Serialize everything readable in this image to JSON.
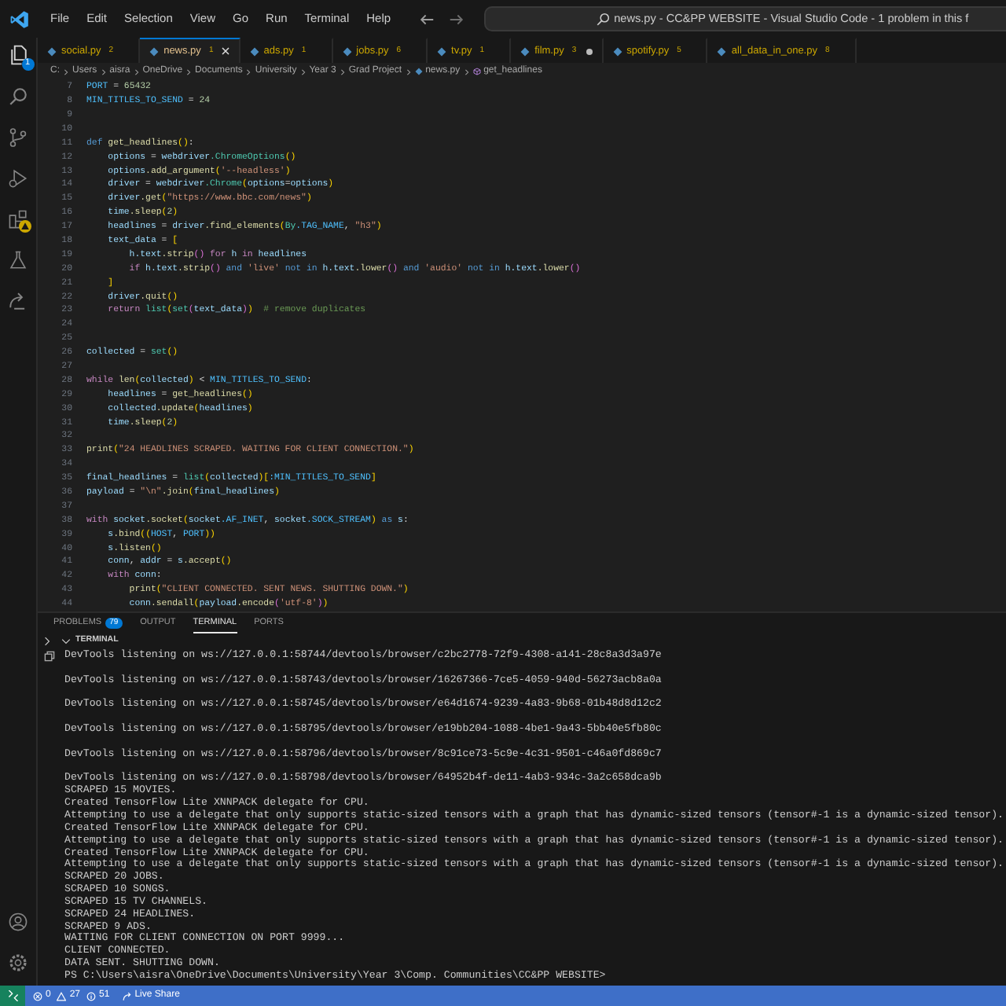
{
  "title_bar": {
    "menu": [
      "File",
      "Edit",
      "Selection",
      "View",
      "Go",
      "Run",
      "Terminal",
      "Help"
    ],
    "command_center": "news.py - CC&PP WEBSITE - Visual Studio Code - 1 problem in this f"
  },
  "activity_bar": {
    "explorer_badge": "1"
  },
  "tabs": [
    {
      "label": "social.py",
      "problems": "2",
      "selected": false,
      "modified": false
    },
    {
      "label": "news.py",
      "problems": "1",
      "selected": true,
      "modified": false
    },
    {
      "label": "ads.py",
      "problems": "1",
      "selected": false,
      "modified": false
    },
    {
      "label": "jobs.py",
      "problems": "6",
      "selected": false,
      "modified": false
    },
    {
      "label": "tv.py",
      "problems": "1",
      "selected": false,
      "modified": false
    },
    {
      "label": "film.py",
      "problems": "3",
      "selected": false,
      "modified": true
    },
    {
      "label": "spotify.py",
      "problems": "5",
      "selected": false,
      "modified": false
    },
    {
      "label": "all_data_in_one.py",
      "problems": "8",
      "selected": false,
      "modified": false
    }
  ],
  "breadcrumbs": [
    "C:",
    "Users",
    "aisra",
    "OneDrive",
    "Documents",
    "University",
    "Year 3",
    "Grad Project",
    "news.py",
    "get_headlines"
  ],
  "editor": {
    "lines": [
      {
        "number": "7",
        "tokens": [
          {
            "kind": "const",
            "text": "PORT"
          },
          {
            "kind": "op",
            "text": " = "
          },
          {
            "kind": "num",
            "text": "65432"
          }
        ]
      },
      {
        "number": "8",
        "tokens": [
          {
            "kind": "const",
            "text": "MIN_TITLES_TO_SEND"
          },
          {
            "kind": "op",
            "text": " = "
          },
          {
            "kind": "num",
            "text": "24"
          }
        ]
      },
      {
        "number": "9"
      },
      {
        "number": "10"
      },
      {
        "number": "11",
        "tokens": [
          {
            "kind": "kw",
            "text": "def "
          },
          {
            "kind": "fn",
            "text": "get_headlines"
          },
          {
            "kind": "br",
            "text": "()"
          },
          {
            "kind": "op",
            "text": ":"
          }
        ]
      },
      {
        "number": "12",
        "tokens": [
          {
            "kind": "var",
            "text": "    options"
          },
          {
            "kind": "op",
            "text": " = "
          },
          {
            "kind": "var",
            "text": "webdriver"
          },
          {
            "kind": "cls",
            "text": ".ChromeOptions"
          },
          {
            "kind": "br",
            "text": "()"
          }
        ]
      },
      {
        "number": "13",
        "tokens": [
          {
            "kind": "var",
            "text": "    options"
          },
          {
            "kind": "fn",
            "text": ".add_argument"
          },
          {
            "kind": "br",
            "text": "("
          },
          {
            "kind": "str",
            "text": "'--headless'"
          },
          {
            "kind": "br",
            "text": ")"
          }
        ]
      },
      {
        "number": "14",
        "tokens": [
          {
            "kind": "var",
            "text": "    driver"
          },
          {
            "kind": "op",
            "text": " = "
          },
          {
            "kind": "var",
            "text": "webdriver"
          },
          {
            "kind": "cls",
            "text": ".Chrome"
          },
          {
            "kind": "br",
            "text": "("
          },
          {
            "kind": "var",
            "text": "options"
          },
          {
            "kind": "op",
            "text": "="
          },
          {
            "kind": "var",
            "text": "options"
          },
          {
            "kind": "br",
            "text": ")"
          }
        ]
      },
      {
        "number": "15",
        "tokens": [
          {
            "kind": "var",
            "text": "    driver"
          },
          {
            "kind": "fn",
            "text": ".get"
          },
          {
            "kind": "br",
            "text": "("
          },
          {
            "kind": "str",
            "text": "\"https://www.bbc.com/news\""
          },
          {
            "kind": "br",
            "text": ")"
          }
        ]
      },
      {
        "number": "16",
        "tokens": [
          {
            "kind": "var",
            "text": "    time"
          },
          {
            "kind": "fn",
            "text": ".sleep"
          },
          {
            "kind": "br",
            "text": "("
          },
          {
            "kind": "num",
            "text": "2"
          },
          {
            "kind": "br",
            "text": ")"
          }
        ]
      },
      {
        "number": "17",
        "tokens": [
          {
            "kind": "var",
            "text": "    headlines"
          },
          {
            "kind": "op",
            "text": " = "
          },
          {
            "kind": "var",
            "text": "driver"
          },
          {
            "kind": "fn",
            "text": ".find_elements"
          },
          {
            "kind": "br",
            "text": "("
          },
          {
            "kind": "cls",
            "text": "By"
          },
          {
            "kind": "const",
            "text": ".TAG_NAME"
          },
          {
            "kind": "op",
            "text": ", "
          },
          {
            "kind": "str",
            "text": "\"h3\""
          },
          {
            "kind": "br",
            "text": ")"
          }
        ]
      },
      {
        "number": "18",
        "tokens": [
          {
            "kind": "var",
            "text": "    text_data"
          },
          {
            "kind": "op",
            "text": " = "
          },
          {
            "kind": "br",
            "text": "["
          }
        ]
      },
      {
        "number": "19",
        "tokens": [
          {
            "kind": "var",
            "text": "        h"
          },
          {
            "kind": "var",
            "text": ".text"
          },
          {
            "kind": "fn",
            "text": ".strip"
          },
          {
            "kind": "br2",
            "text": "()"
          },
          {
            "kind": "ctl",
            "text": " for "
          },
          {
            "kind": "var",
            "text": "h"
          },
          {
            "kind": "ctl",
            "text": " in "
          },
          {
            "kind": "var",
            "text": "headlines"
          }
        ]
      },
      {
        "number": "20",
        "tokens": [
          {
            "kind": "ctl",
            "text": "        if "
          },
          {
            "kind": "var",
            "text": "h"
          },
          {
            "kind": "var",
            "text": ".text"
          },
          {
            "kind": "fn",
            "text": ".strip"
          },
          {
            "kind": "br2",
            "text": "()"
          },
          {
            "kind": "kw",
            "text": " and "
          },
          {
            "kind": "str",
            "text": "'live'"
          },
          {
            "kind": "kw",
            "text": " not in "
          },
          {
            "kind": "var",
            "text": "h"
          },
          {
            "kind": "var",
            "text": ".text"
          },
          {
            "kind": "fn",
            "text": ".lower"
          },
          {
            "kind": "br2",
            "text": "()"
          },
          {
            "kind": "kw",
            "text": " and "
          },
          {
            "kind": "str",
            "text": "'audio'"
          },
          {
            "kind": "kw",
            "text": " not in "
          },
          {
            "kind": "var",
            "text": "h"
          },
          {
            "kind": "var",
            "text": ".text"
          },
          {
            "kind": "fn",
            "text": ".lower"
          },
          {
            "kind": "br2",
            "text": "()"
          }
        ]
      },
      {
        "number": "21",
        "tokens": [
          {
            "kind": "br",
            "text": "    ]"
          }
        ]
      },
      {
        "number": "22",
        "tokens": [
          {
            "kind": "var",
            "text": "    driver"
          },
          {
            "kind": "fn",
            "text": ".quit"
          },
          {
            "kind": "br",
            "text": "()"
          }
        ]
      },
      {
        "number": "23",
        "tokens": [
          {
            "kind": "ctl",
            "text": "    return "
          },
          {
            "kind": "cls",
            "text": "list"
          },
          {
            "kind": "br",
            "text": "("
          },
          {
            "kind": "cls",
            "text": "set"
          },
          {
            "kind": "br2",
            "text": "("
          },
          {
            "kind": "var",
            "text": "text_data"
          },
          {
            "kind": "br2",
            "text": ")"
          },
          {
            "kind": "br",
            "text": ")"
          },
          {
            "kind": "com",
            "text": "  # remove duplicates"
          }
        ]
      },
      {
        "number": "24"
      },
      {
        "number": "25"
      },
      {
        "number": "26",
        "tokens": [
          {
            "kind": "var",
            "text": "collected"
          },
          {
            "kind": "op",
            "text": " = "
          },
          {
            "kind": "cls",
            "text": "set"
          },
          {
            "kind": "br",
            "text": "()"
          }
        ]
      },
      {
        "number": "27"
      },
      {
        "number": "28",
        "tokens": [
          {
            "kind": "ctl",
            "text": "while "
          },
          {
            "kind": "fn",
            "text": "len"
          },
          {
            "kind": "br",
            "text": "("
          },
          {
            "kind": "var",
            "text": "collected"
          },
          {
            "kind": "br",
            "text": ")"
          },
          {
            "kind": "op",
            "text": " < "
          },
          {
            "kind": "const",
            "text": "MIN_TITLES_TO_SEND"
          },
          {
            "kind": "op",
            "text": ":"
          }
        ]
      },
      {
        "number": "29",
        "tokens": [
          {
            "kind": "var",
            "text": "    headlines"
          },
          {
            "kind": "op",
            "text": " = "
          },
          {
            "kind": "fn",
            "text": "get_headlines"
          },
          {
            "kind": "br",
            "text": "()"
          }
        ]
      },
      {
        "number": "30",
        "tokens": [
          {
            "kind": "var",
            "text": "    collected"
          },
          {
            "kind": "fn",
            "text": ".update"
          },
          {
            "kind": "br",
            "text": "("
          },
          {
            "kind": "var",
            "text": "headlines"
          },
          {
            "kind": "br",
            "text": ")"
          }
        ]
      },
      {
        "number": "31",
        "tokens": [
          {
            "kind": "var",
            "text": "    time"
          },
          {
            "kind": "fn",
            "text": ".sleep"
          },
          {
            "kind": "br",
            "text": "("
          },
          {
            "kind": "num",
            "text": "2"
          },
          {
            "kind": "br",
            "text": ")"
          }
        ]
      },
      {
        "number": "32"
      },
      {
        "number": "33",
        "tokens": [
          {
            "kind": "fn",
            "text": "print"
          },
          {
            "kind": "br",
            "text": "("
          },
          {
            "kind": "str",
            "text": "\"24 HEADLINES SCRAPED. WAITING FOR CLIENT CONNECTION.\""
          },
          {
            "kind": "br",
            "text": ")"
          }
        ]
      },
      {
        "number": "34"
      },
      {
        "number": "35",
        "tokens": [
          {
            "kind": "var",
            "text": "final_headlines"
          },
          {
            "kind": "op",
            "text": " = "
          },
          {
            "kind": "cls",
            "text": "list"
          },
          {
            "kind": "br",
            "text": "("
          },
          {
            "kind": "var",
            "text": "collected"
          },
          {
            "kind": "br",
            "text": ")["
          },
          {
            "kind": "const",
            "text": ":MIN_TITLES_TO_SEND"
          },
          {
            "kind": "br",
            "text": "]"
          }
        ]
      },
      {
        "number": "36",
        "tokens": [
          {
            "kind": "var",
            "text": "payload"
          },
          {
            "kind": "op",
            "text": " = "
          },
          {
            "kind": "str",
            "text": "\"\\n\""
          },
          {
            "kind": "fn",
            "text": ".join"
          },
          {
            "kind": "br",
            "text": "("
          },
          {
            "kind": "var",
            "text": "final_headlines"
          },
          {
            "kind": "br",
            "text": ")"
          }
        ]
      },
      {
        "number": "37"
      },
      {
        "number": "38",
        "tokens": [
          {
            "kind": "ctl",
            "text": "with "
          },
          {
            "kind": "var",
            "text": "socket"
          },
          {
            "kind": "fn",
            "text": ".socket"
          },
          {
            "kind": "br",
            "text": "("
          },
          {
            "kind": "var",
            "text": "socket"
          },
          {
            "kind": "const",
            "text": ".AF_INET"
          },
          {
            "kind": "op",
            "text": ", "
          },
          {
            "kind": "var",
            "text": "socket"
          },
          {
            "kind": "const",
            "text": ".SOCK_STREAM"
          },
          {
            "kind": "br",
            "text": ")"
          },
          {
            "kind": "kw",
            "text": " as "
          },
          {
            "kind": "var",
            "text": "s"
          },
          {
            "kind": "op",
            "text": ":"
          }
        ]
      },
      {
        "number": "39",
        "tokens": [
          {
            "kind": "var",
            "text": "    s"
          },
          {
            "kind": "fn",
            "text": ".bind"
          },
          {
            "kind": "br",
            "text": "(("
          },
          {
            "kind": "const",
            "text": "HOST"
          },
          {
            "kind": "op",
            "text": ", "
          },
          {
            "kind": "const",
            "text": "PORT"
          },
          {
            "kind": "br",
            "text": "))"
          }
        ]
      },
      {
        "number": "40",
        "tokens": [
          {
            "kind": "var",
            "text": "    s"
          },
          {
            "kind": "fn",
            "text": ".listen"
          },
          {
            "kind": "br",
            "text": "()"
          }
        ]
      },
      {
        "number": "41",
        "tokens": [
          {
            "kind": "var",
            "text": "    conn"
          },
          {
            "kind": "op",
            "text": ", "
          },
          {
            "kind": "var",
            "text": "addr"
          },
          {
            "kind": "op",
            "text": " = "
          },
          {
            "kind": "var",
            "text": "s"
          },
          {
            "kind": "fn",
            "text": ".accept"
          },
          {
            "kind": "br",
            "text": "()"
          }
        ]
      },
      {
        "number": "42",
        "tokens": [
          {
            "kind": "ctl",
            "text": "    with "
          },
          {
            "kind": "var",
            "text": "conn"
          },
          {
            "kind": "op",
            "text": ":"
          }
        ]
      },
      {
        "number": "43",
        "tokens": [
          {
            "kind": "fn",
            "text": "        print"
          },
          {
            "kind": "br",
            "text": "("
          },
          {
            "kind": "str",
            "text": "\"CLIENT CONNECTED. SENT NEWS. SHUTTING DOWN.\""
          },
          {
            "kind": "br",
            "text": ")"
          }
        ]
      },
      {
        "number": "44",
        "tokens": [
          {
            "kind": "var",
            "text": "        conn"
          },
          {
            "kind": "fn",
            "text": ".sendall"
          },
          {
            "kind": "br",
            "text": "("
          },
          {
            "kind": "var",
            "text": "payload"
          },
          {
            "kind": "fn",
            "text": ".encode"
          },
          {
            "kind": "br2",
            "text": "("
          },
          {
            "kind": "str",
            "text": "'utf-8'"
          },
          {
            "kind": "br2",
            "text": ")"
          },
          {
            "kind": "br",
            "text": ")"
          }
        ]
      }
    ]
  },
  "panel": {
    "tabs": [
      {
        "label": "PROBLEMS",
        "badge": "79",
        "selected": false
      },
      {
        "label": "OUTPUT",
        "selected": false
      },
      {
        "label": "TERMINAL",
        "selected": true
      },
      {
        "label": "PORTS",
        "selected": false
      }
    ],
    "section_title": "TERMINAL",
    "terminal_lines": [
      {
        "text": "DevTools listening on ws://127.0.0.1:58744/devtools/browser/c2bc2778-72f9-4308-a141-28c8a3d3a97e",
        "spaced": true
      },
      {
        "text": "DevTools listening on ws://127.0.0.1:58743/devtools/browser/16267366-7ce5-4059-940d-56273acb8a0a",
        "spaced": true
      },
      {
        "text": "DevTools listening on ws://127.0.0.1:58745/devtools/browser/e64d1674-9239-4a83-9b68-01b48d8d12c2",
        "spaced": true
      },
      {
        "text": "DevTools listening on ws://127.0.0.1:58795/devtools/browser/e19bb204-1088-4be1-9a43-5bb40e5fb80c",
        "spaced": true
      },
      {
        "text": "DevTools listening on ws://127.0.0.1:58796/devtools/browser/8c91ce73-5c9e-4c31-9501-c46a0fd869c7",
        "spaced": true
      },
      {
        "text": "DevTools listening on ws://127.0.0.1:58798/devtools/browser/64952b4f-de11-4ab3-934c-3a2c658dca9b",
        "spaced": false
      },
      {
        "text": "SCRAPED 15 MOVIES.",
        "spaced": false
      },
      {
        "text": "Created TensorFlow Lite XNNPACK delegate for CPU.",
        "spaced": false
      },
      {
        "text": "Attempting to use a delegate that only supports static-sized tensors with a graph that has dynamic-sized tensors (tensor#-1 is a dynamic-sized tensor).",
        "spaced": false
      },
      {
        "text": "Created TensorFlow Lite XNNPACK delegate for CPU.",
        "spaced": false
      },
      {
        "text": "Attempting to use a delegate that only supports static-sized tensors with a graph that has dynamic-sized tensors (tensor#-1 is a dynamic-sized tensor).",
        "spaced": false
      },
      {
        "text": "Created TensorFlow Lite XNNPACK delegate for CPU.",
        "spaced": false
      },
      {
        "text": "Attempting to use a delegate that only supports static-sized tensors with a graph that has dynamic-sized tensors (tensor#-1 is a dynamic-sized tensor).",
        "spaced": false
      },
      {
        "text": "SCRAPED 20 JOBS.",
        "spaced": false
      },
      {
        "text": "SCRAPED 10 SONGS.",
        "spaced": false
      },
      {
        "text": "SCRAPED 15 TV CHANNELS.",
        "spaced": false
      },
      {
        "text": "SCRAPED 24 HEADLINES.",
        "spaced": false
      },
      {
        "text": "SCRAPED 9 ADS.",
        "spaced": false
      },
      {
        "text": "WAITING FOR CLIENT CONNECTION ON PORT 9999...",
        "spaced": false
      },
      {
        "text": "CLIENT CONNECTED.",
        "spaced": false
      },
      {
        "text": "DATA SENT. SHUTTING DOWN.",
        "spaced": false
      },
      {
        "text": "PS C:\\Users\\aisra\\OneDrive\\Documents\\University\\Year 3\\Comp. Communities\\CC&PP WEBSITE>",
        "spaced": false
      }
    ]
  },
  "status_bar": {
    "errors": "0",
    "warnings": "27",
    "infos": "51",
    "live_share": "Live Share"
  }
}
